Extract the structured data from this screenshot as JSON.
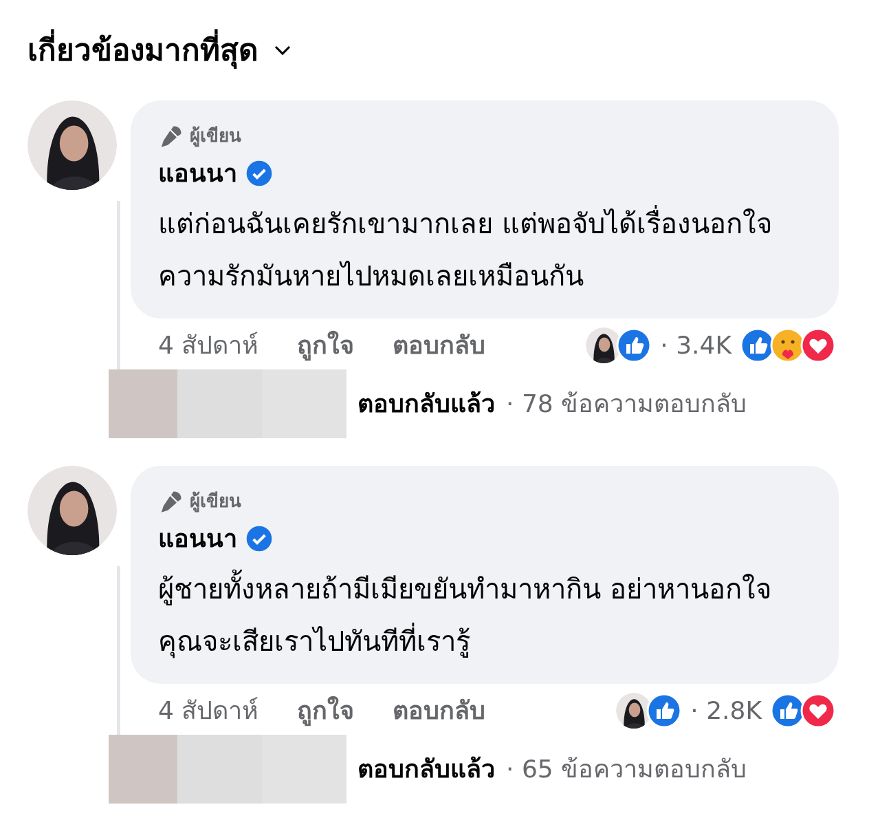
{
  "sort_menu": {
    "label": "เกี่ยวข้องมากที่สุด"
  },
  "comments": [
    {
      "badge": "ผู้เขียน",
      "author": "แอนนา",
      "verified": true,
      "text": "แต่ก่อนฉันเคยรักเขามากเลย แต่พอจับได้เรื่องนอกใจความรักมันหายไปหมดเลยเหมือนกัน",
      "time": "4 สัปดาห์",
      "like": "ถูกใจ",
      "reply": "ตอบกลับ",
      "count": "· 3.4K",
      "reactions": [
        {
          "kind": "like"
        },
        {
          "kind": "care"
        },
        {
          "kind": "love"
        }
      ],
      "replied": "ตอบกลับแล้ว",
      "replies": "· 78 ข้อความตอบกลับ"
    },
    {
      "badge": "ผู้เขียน",
      "author": "แอนนา",
      "verified": true,
      "text": "ผู้ชายทั้งหลายถ้ามีเมียขยันทำมาหากิน อย่าหานอกใจ คุณจะเสียเราไปทันทีที่เรารู้",
      "time": "4 สัปดาห์",
      "like": "ถูกใจ",
      "reply": "ตอบกลับ",
      "count": "· 2.8K",
      "reactions": [
        {
          "kind": "like"
        },
        {
          "kind": "love"
        }
      ],
      "replied": "ตอบกลับแล้ว",
      "replies": "· 65 ข้อความตอบกลับ"
    }
  ]
}
